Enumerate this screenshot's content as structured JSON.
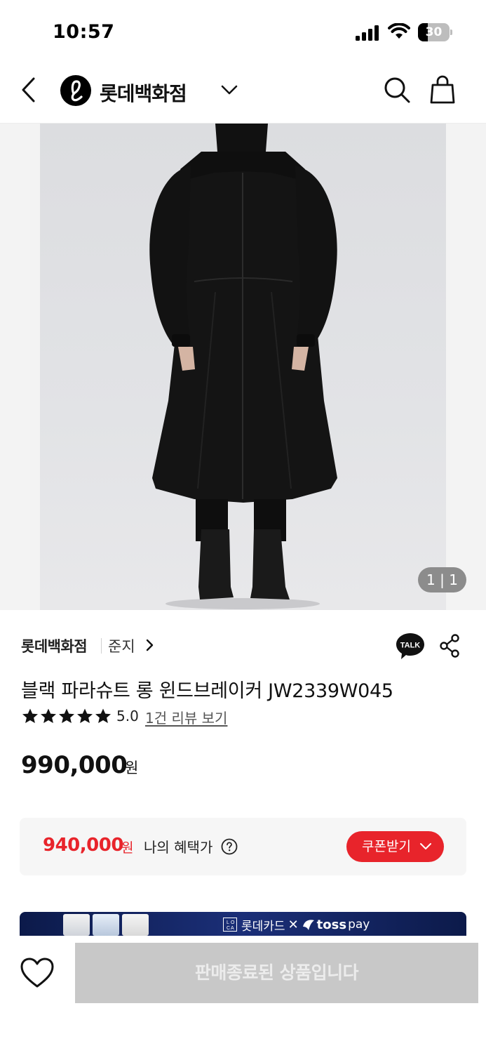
{
  "status_bar": {
    "time": "10:57",
    "battery": "30",
    "battery_level_percent": 30,
    "icons": [
      "signal-icon",
      "wifi-icon",
      "battery-icon"
    ]
  },
  "header": {
    "back_icon": "chevron-left-icon",
    "brand_name": "롯데백화점",
    "brand_dropdown_icon": "chevron-down-icon",
    "search_icon": "search-icon",
    "bag_icon": "shopping-bag-icon"
  },
  "gallery": {
    "counter": "1 | 1"
  },
  "product": {
    "store": "롯데백화점",
    "seller": "준지",
    "title": "블랙 파라슈트 롱 윈드브레이커 JW2339W045",
    "rating": 5.0,
    "rating_text": "5.0",
    "stars": 5,
    "review_link": "1건 리뷰 보기",
    "price": "990,000",
    "price_unit": "원"
  },
  "benefit": {
    "price": "940,000",
    "price_unit": "원",
    "label": "나의 혜택가",
    "coupon_button": "쿠폰받기"
  },
  "banner": {
    "card_text": "롯데카드",
    "cross": "✕",
    "toss": "toss",
    "pay": "pay"
  },
  "bottom": {
    "soldout_label": "판매종료된 상품입니다"
  },
  "colors": {
    "accent": "#e8242b",
    "banner": "#1b2f78",
    "disabled": "#c8c8c8"
  }
}
